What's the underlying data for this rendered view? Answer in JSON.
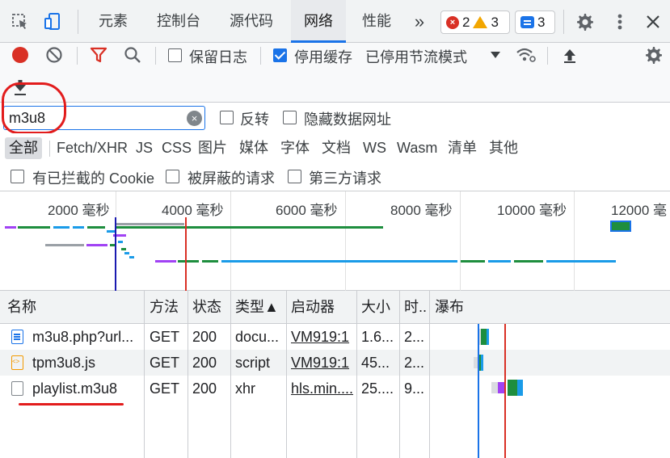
{
  "tabs": {
    "elements": "元素",
    "console": "控制台",
    "sources": "源代码",
    "network": "网络",
    "performance": "性能",
    "more": "»"
  },
  "badges": {
    "errors": "2",
    "warnings": "3",
    "messages": "3"
  },
  "toolbar": {
    "preserve_log": "保留日志",
    "disable_cache": "停用缓存",
    "throttling": "已停用节流模式"
  },
  "filter": {
    "value": "m3u8",
    "invert": "反转",
    "hide_data_urls": "隐藏数据网址"
  },
  "type_filters": [
    "全部",
    "Fetch/XHR",
    "JS",
    "CSS",
    "图片",
    "媒体",
    "字体",
    "文档",
    "WS",
    "Wasm",
    "清单",
    "其他"
  ],
  "block_filters": {
    "blocked_cookies": "有已拦截的 Cookie",
    "blocked_requests": "被屏蔽的请求",
    "third_party": "第三方请求"
  },
  "overview": {
    "ticks": [
      "2000 毫秒",
      "4000 毫秒",
      "6000 毫秒",
      "8000 毫秒",
      "10000 毫秒",
      "12000 毫"
    ]
  },
  "table": {
    "headers": {
      "name": "名称",
      "method": "方法",
      "status": "状态",
      "type": "类型▲",
      "initiator": "启动器",
      "size": "大小",
      "time": "时..",
      "waterfall": "瀑布"
    },
    "rows": [
      {
        "name": "m3u8.php?url...",
        "method": "GET",
        "status": "200",
        "type": "docu...",
        "initiator": "VM919:1",
        "size": "1.6...",
        "time": "2...",
        "icon": "document-icon"
      },
      {
        "name": "tpm3u8.js",
        "method": "GET",
        "status": "200",
        "type": "script",
        "initiator": "VM919:1",
        "size": "45...",
        "time": "2...",
        "icon": "script-icon"
      },
      {
        "name": "playlist.m3u8",
        "method": "GET",
        "status": "200",
        "type": "xhr",
        "initiator": "hls.min....",
        "size": "25....",
        "time": "9...",
        "icon": "file-icon"
      }
    ]
  },
  "colors": {
    "accent": "#1a73e8",
    "record": "#d93025",
    "annotation": "#e21c1c"
  }
}
